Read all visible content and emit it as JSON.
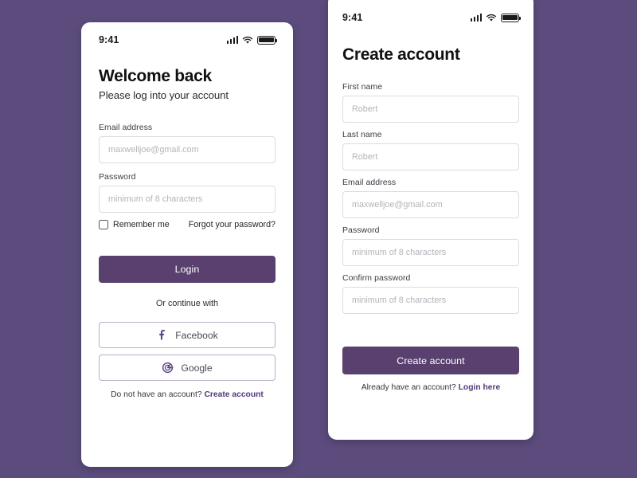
{
  "theme": {
    "background": "#5c4c7d",
    "primary": "#59406f",
    "link": "#54397a",
    "border": "#dcdcdf",
    "social_border": "#b9aec9",
    "placeholder": "#b4b4bb"
  },
  "login_screen": {
    "status_bar": {
      "time": "9:41",
      "icons": [
        "signal-icon",
        "wifi-icon",
        "battery-icon"
      ]
    },
    "title": "Welcome back",
    "subtitle": "Please log into your account",
    "fields": [
      {
        "label": "Email address",
        "placeholder": "maxwelljoe@gmail.com",
        "value": "",
        "type": "email"
      },
      {
        "label": "Password",
        "placeholder": "minimum of 8 characters",
        "value": "",
        "type": "password"
      }
    ],
    "remember_label": "Remember me",
    "remember_checked": false,
    "forgot_label": "Forgot your password?",
    "submit_label": "Login",
    "divider_label": "Or continue with",
    "social_buttons": [
      {
        "label": "Facebook",
        "icon": "facebook-icon"
      },
      {
        "label": "Google",
        "icon": "google-icon"
      }
    ],
    "footer_prefix": "Do not have an account? ",
    "footer_link": "Create account"
  },
  "signup_screen": {
    "status_bar": {
      "time": "9:41",
      "icons": [
        "signal-icon",
        "wifi-icon",
        "battery-icon"
      ]
    },
    "title": "Create account",
    "fields": [
      {
        "label": "First name",
        "placeholder": "Robert",
        "value": "",
        "type": "text"
      },
      {
        "label": "Last name",
        "placeholder": "Robert",
        "value": "",
        "type": "text"
      },
      {
        "label": "Email address",
        "placeholder": "maxwelljoe@gmail.com",
        "value": "",
        "type": "email"
      },
      {
        "label": "Password",
        "placeholder": "minimum of 8 characters",
        "value": "",
        "type": "password"
      },
      {
        "label": "Confirm password",
        "placeholder": "minimum of 8 characters",
        "value": "",
        "type": "password"
      }
    ],
    "submit_label": "Create account",
    "footer_prefix": "Already have an account? ",
    "footer_link": "Login here"
  }
}
